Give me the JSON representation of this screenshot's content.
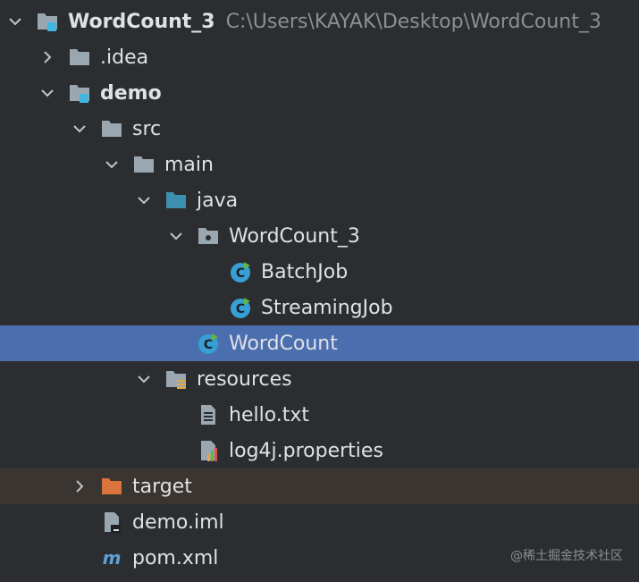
{
  "project": {
    "name": "WordCount_3",
    "path": "C:\\Users\\KAYAK\\Desktop\\WordCount_3"
  },
  "tree": {
    "idea": ".idea",
    "demo": "demo",
    "src": "src",
    "main": "main",
    "java": "java",
    "pkg": "WordCount_3",
    "batch": "BatchJob",
    "streaming": "StreamingJob",
    "wordcount": "WordCount",
    "resources": "resources",
    "hello": "hello.txt",
    "log4j": "log4j.properties",
    "target": "target",
    "iml": "demo.iml",
    "pom": "pom.xml"
  },
  "watermark": "@稀土掘金技术社区",
  "colors": {
    "background": "#2b2d30",
    "selection": "#4b6eaf",
    "excluded_row": "#3a3531",
    "folder": "#9aa7b0",
    "source_folder": "#3d8fb0",
    "class_icon": "#389fd6",
    "excluded_folder": "#d9743c"
  }
}
